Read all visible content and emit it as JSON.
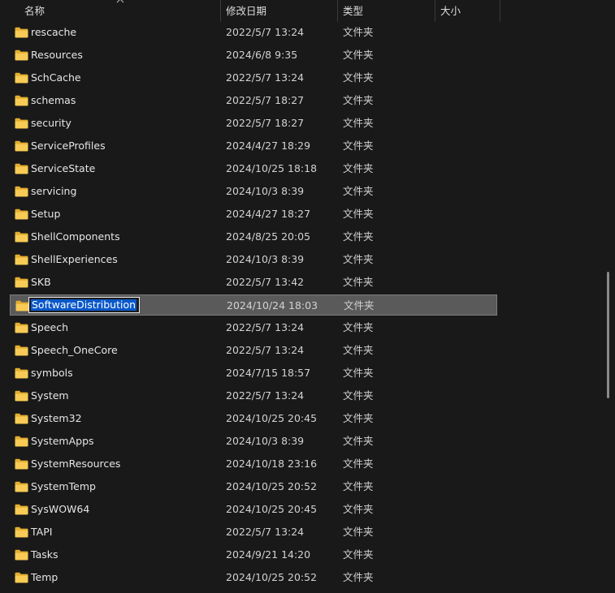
{
  "header": {
    "name": "名称",
    "date": "修改日期",
    "type": "类型",
    "size": "大小"
  },
  "colors": {
    "background": "#191919",
    "selected_row": "#5a5a5a",
    "selection_highlight": "#0a58c9",
    "folder": "#f4c64a"
  },
  "rows": [
    {
      "name": "rescache",
      "date": "2022/5/7 13:24",
      "type": "文件夹"
    },
    {
      "name": "Resources",
      "date": "2024/6/8 9:35",
      "type": "文件夹"
    },
    {
      "name": "SchCache",
      "date": "2022/5/7 13:24",
      "type": "文件夹"
    },
    {
      "name": "schemas",
      "date": "2022/5/7 18:27",
      "type": "文件夹"
    },
    {
      "name": "security",
      "date": "2022/5/7 18:27",
      "type": "文件夹"
    },
    {
      "name": "ServiceProfiles",
      "date": "2024/4/27 18:29",
      "type": "文件夹"
    },
    {
      "name": "ServiceState",
      "date": "2024/10/25 18:18",
      "type": "文件夹"
    },
    {
      "name": "servicing",
      "date": "2024/10/3 8:39",
      "type": "文件夹"
    },
    {
      "name": "Setup",
      "date": "2024/4/27 18:27",
      "type": "文件夹"
    },
    {
      "name": "ShellComponents",
      "date": "2024/8/25 20:05",
      "type": "文件夹"
    },
    {
      "name": "ShellExperiences",
      "date": "2024/10/3 8:39",
      "type": "文件夹"
    },
    {
      "name": "SKB",
      "date": "2022/5/7 13:42",
      "type": "文件夹"
    },
    {
      "name": "SoftwareDistribution",
      "date": "2024/10/24 18:03",
      "type": "文件夹",
      "selected": true,
      "renaming": true
    },
    {
      "name": "Speech",
      "date": "2022/5/7 13:24",
      "type": "文件夹"
    },
    {
      "name": "Speech_OneCore",
      "date": "2022/5/7 13:24",
      "type": "文件夹"
    },
    {
      "name": "symbols",
      "date": "2024/7/15 18:57",
      "type": "文件夹"
    },
    {
      "name": "System",
      "date": "2022/5/7 13:24",
      "type": "文件夹"
    },
    {
      "name": "System32",
      "date": "2024/10/25 20:45",
      "type": "文件夹"
    },
    {
      "name": "SystemApps",
      "date": "2024/10/3 8:39",
      "type": "文件夹"
    },
    {
      "name": "SystemResources",
      "date": "2024/10/18 23:16",
      "type": "文件夹"
    },
    {
      "name": "SystemTemp",
      "date": "2024/10/25 20:52",
      "type": "文件夹"
    },
    {
      "name": "SysWOW64",
      "date": "2024/10/25 20:45",
      "type": "文件夹"
    },
    {
      "name": "TAPI",
      "date": "2022/5/7 13:24",
      "type": "文件夹"
    },
    {
      "name": "Tasks",
      "date": "2024/9/21 14:20",
      "type": "文件夹"
    },
    {
      "name": "Temp",
      "date": "2024/10/25 20:52",
      "type": "文件夹"
    }
  ]
}
